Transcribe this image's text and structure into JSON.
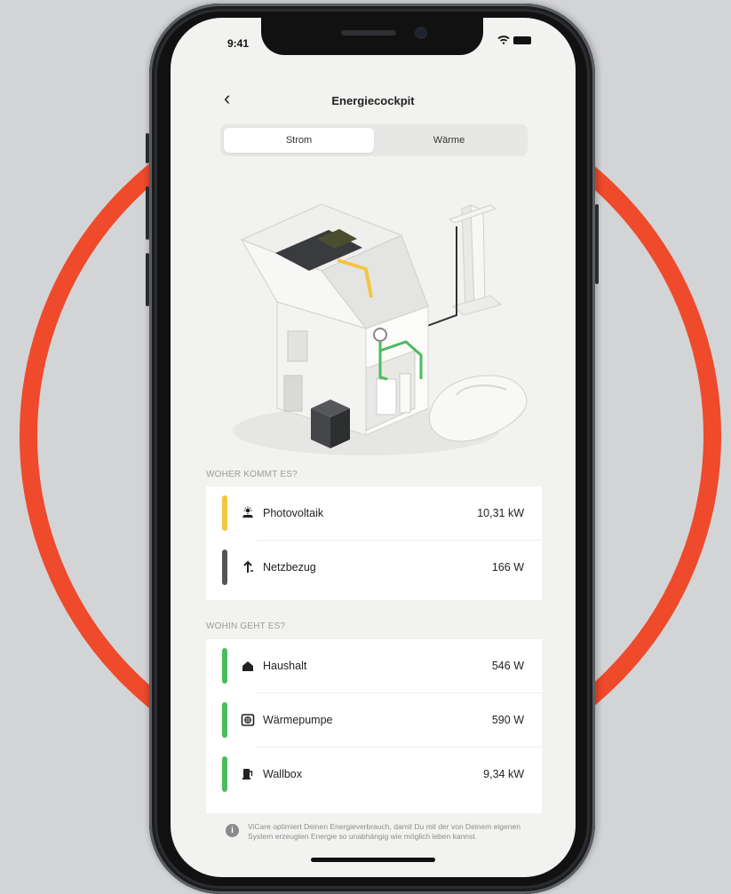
{
  "colors": {
    "accent_ring": "#ee4a2b",
    "photovoltaik_bar": "#f4c542",
    "netz_bar": "#555555",
    "consumer_bar": "#4cbb5e"
  },
  "status_bar": {
    "time": "9:41",
    "icons": [
      "wifi-icon",
      "battery-icon"
    ]
  },
  "header": {
    "back_icon": "chevron-left-icon",
    "title": "Energiecockpit"
  },
  "tabs": [
    {
      "label": "Strom",
      "active": true
    },
    {
      "label": "Wärme",
      "active": false
    }
  ],
  "sources": {
    "section_label": "WOHER KOMMT ES?",
    "items": [
      {
        "label": "Photovoltaik",
        "value": "10,31 kW",
        "icon": "solar-panel-icon"
      },
      {
        "label": "Netzbezug",
        "value": "166 W",
        "icon": "grid-import-icon"
      }
    ]
  },
  "consumers": {
    "section_label": "WOHIN GEHT ES?",
    "items": [
      {
        "label": "Haushalt",
        "value": "546 W",
        "icon": "house-icon"
      },
      {
        "label": "Wärmepumpe",
        "value": "590 W",
        "icon": "heat-pump-icon"
      },
      {
        "label": "Wallbox",
        "value": "9,34 kW",
        "icon": "wallbox-icon"
      }
    ]
  },
  "info": {
    "icon": "info-icon",
    "text": "ViCare optimiert Deinen Energieverbrauch, damit Du mit der von Deinem eigenen System erzeugten Energie so unabhängig wie möglich leben kannst."
  }
}
